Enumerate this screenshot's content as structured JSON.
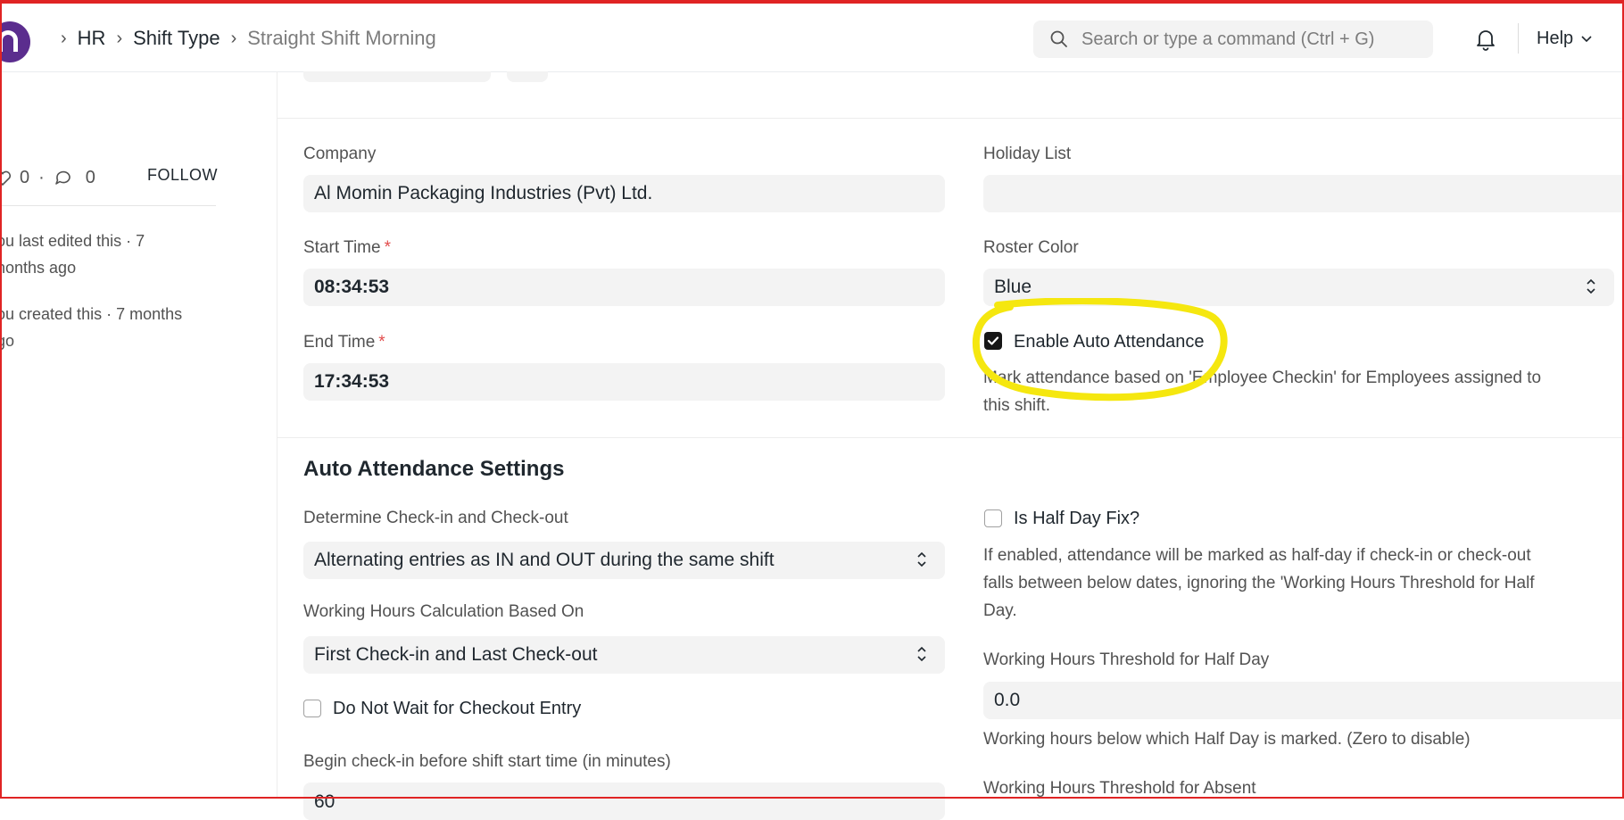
{
  "navbar": {
    "breadcrumbs": [
      "HR",
      "Shift Type",
      "Straight Shift Morning"
    ],
    "search_placeholder": "Search or type a command (Ctrl + G)",
    "help_label": "Help"
  },
  "sidebar": {
    "likes_count": "0",
    "comments_count": "0",
    "follow_label": "FOLLOW",
    "timeline": [
      {
        "text": "ou last edited this · 7 months ago",
        "line1": "ou last edited this · 7",
        "line2": "nonths ago"
      },
      {
        "text": "ou created this · 7 months ago",
        "line1": "ou created this · 7 months",
        "line2": "go"
      }
    ]
  },
  "form": {
    "company": {
      "label": "Company",
      "value": "Al Momin Packaging Industries (Pvt) Ltd."
    },
    "holiday_list": {
      "label": "Holiday List",
      "value": ""
    },
    "start_time": {
      "label": "Start Time",
      "required_mark": "*",
      "value": "08:34:53"
    },
    "roster_color": {
      "label": "Roster Color",
      "value": "Blue"
    },
    "end_time": {
      "label": "End Time",
      "required_mark": "*",
      "value": "17:34:53"
    },
    "enable_auto_attendance": {
      "label": "Enable Auto Attendance",
      "checked": true,
      "description_line1": "Mark attendance based on 'Employee Checkin' for Employees assigned to",
      "description_line2": "this shift."
    },
    "auto_attendance_section": {
      "title": "Auto Attendance Settings",
      "determine_checkin": {
        "label": "Determine Check-in and Check-out",
        "value": "Alternating entries as IN and OUT during the same shift"
      },
      "working_hours_calc": {
        "label": "Working Hours Calculation Based On",
        "value": "First Check-in and Last Check-out"
      },
      "do_not_wait_checkout": {
        "label": "Do Not Wait for Checkout Entry",
        "checked": false
      },
      "begin_checkin": {
        "label": "Begin check-in before shift start time (in minutes)",
        "value": "60"
      },
      "is_half_day_fix": {
        "label": "Is Half Day Fix?",
        "checked": false,
        "description_line1": "If enabled, attendance will be marked as half-day if check-in or check-out",
        "description_line2": "falls between below dates, ignoring the 'Working Hours Threshold for Half",
        "description_line3": "Day."
      },
      "threshold_half_day": {
        "label": "Working Hours Threshold for Half Day",
        "value": "0.0",
        "description": "Working hours below which Half Day is marked. (Zero to disable)"
      },
      "threshold_absent": {
        "label": "Working Hours Threshold for Absent"
      }
    }
  },
  "colors": {
    "brand": "#5b2d8e",
    "highlight": "#f5e70f",
    "required": "#e24c4c",
    "frame": "#e02424"
  }
}
